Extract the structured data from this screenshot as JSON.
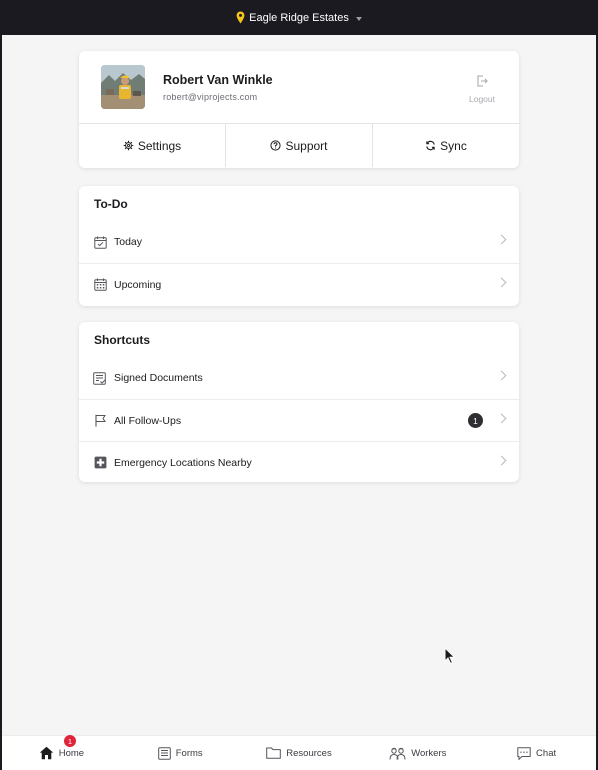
{
  "topbar": {
    "location": "Eagle Ridge Estates",
    "pin_color": "#f5c518"
  },
  "profile": {
    "name": "Robert Van Winkle",
    "email": "robert@viprojects.com",
    "logout_label": "Logout",
    "actions": [
      {
        "label": "Settings",
        "icon": "gear-icon"
      },
      {
        "label": "Support",
        "icon": "help-circle-icon"
      },
      {
        "label": "Sync",
        "icon": "sync-icon"
      }
    ]
  },
  "todo": {
    "title": "To-Do",
    "items": [
      {
        "label": "Today",
        "icon": "calendar-check-icon"
      },
      {
        "label": "Upcoming",
        "icon": "calendar-icon"
      }
    ]
  },
  "shortcuts": {
    "title": "Shortcuts",
    "items": [
      {
        "label": "Signed Documents",
        "icon": "document-check-icon"
      },
      {
        "label": "All Follow-Ups",
        "icon": "flag-icon",
        "badge": "1"
      },
      {
        "label": "Emergency Locations Nearby",
        "icon": "medical-cross-icon"
      }
    ]
  },
  "bottom_nav": {
    "items": [
      {
        "label": "Home",
        "icon": "home-icon",
        "badge": "1"
      },
      {
        "label": "Forms",
        "icon": "forms-icon"
      },
      {
        "label": "Resources",
        "icon": "folder-icon"
      },
      {
        "label": "Workers",
        "icon": "workers-icon"
      },
      {
        "label": "Chat",
        "icon": "chat-icon"
      }
    ]
  },
  "colors": {
    "accent": "#f5c518",
    "badge_red": "#e0243a",
    "dark": "#1b1a21"
  }
}
